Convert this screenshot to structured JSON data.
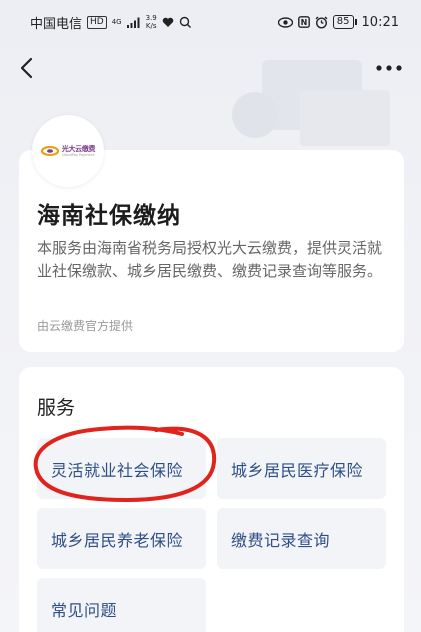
{
  "status_bar": {
    "carrier": "中国电信",
    "hd": "HD",
    "signal_label": "4G",
    "speed_value": "3.9",
    "speed_unit": "K/s",
    "battery": "85",
    "time": "10:21"
  },
  "nav": {
    "back_icon": "chevron-left-icon",
    "more_icon": "more-horizontal-icon"
  },
  "info": {
    "logo_cn": "光大云缴费",
    "logo_en": "CloudPay Payment",
    "title": "海南社保缴纳",
    "description": "本服务由海南省税务局授权光大云缴费，提供灵活就业社保缴款、城乡居民缴费、缴费记录查询等服务。",
    "provider": "由云缴费官方提供"
  },
  "services": {
    "heading": "服务",
    "items": [
      {
        "label": "灵活就业社会保险"
      },
      {
        "label": "城乡居民医疗保险"
      },
      {
        "label": "城乡居民养老保险"
      },
      {
        "label": "缴费记录查询"
      },
      {
        "label": "常见问题"
      }
    ],
    "highlighted_item": "灵活就业社会保险",
    "highlight_color": "#e0231c"
  },
  "colors": {
    "service_text": "#2e4f86",
    "card_bg": "#ffffff",
    "page_bg": "#eef0f4"
  }
}
